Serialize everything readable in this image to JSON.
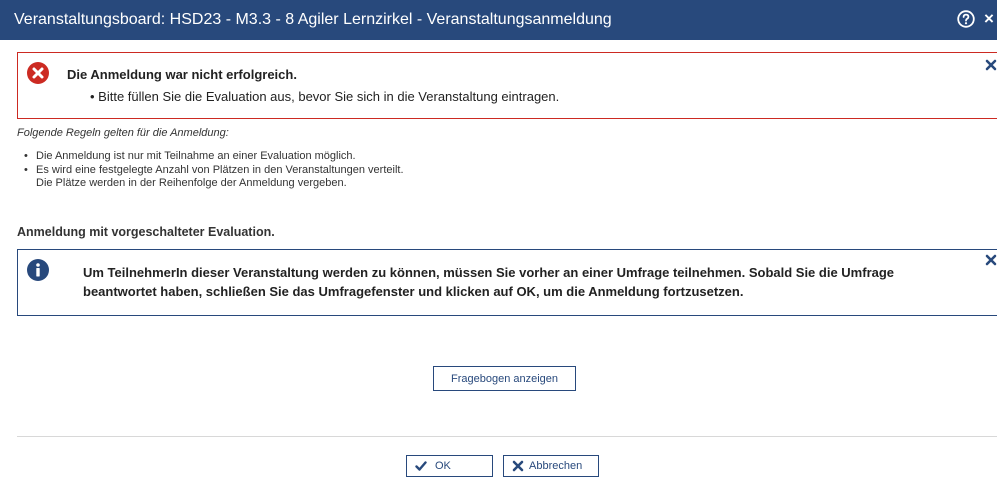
{
  "window": {
    "title": "Veranstaltungsboard: HSD23 - M3.3 - 8 Agiler Lernzirkel - Veranstaltungsanmeldung",
    "help_icon": "help-circle-icon",
    "close_icon": "close-icon",
    "close_glyph": "×"
  },
  "error_message": {
    "icon": "error-circle-icon",
    "title": "Die Anmeldung war nicht erfolgreich.",
    "bullet": "Bitte füllen Sie die Evaluation aus, bevor Sie sich in die Veranstaltung eintragen.",
    "color": "#cc2a22"
  },
  "rules": {
    "intro": "Folgende Regeln gelten für die Anmeldung:",
    "items": [
      {
        "text": "Die Anmeldung ist nur mit Teilnahme an einer Evaluation möglich."
      },
      {
        "text": "Es wird eine festgelegte Anzahl von Plätzen in den Veranstaltungen verteilt.",
        "continuation": "Die Plätze werden in der Reihenfolge der Anmeldung vergeben."
      }
    ]
  },
  "section_heading": "Anmeldung mit vorgeschalteter Evaluation.",
  "info_message": {
    "icon": "info-circle-icon",
    "text": "Um TeilnehmerIn dieser Veranstaltung werden zu können, müssen Sie vorher an einer Umfrage teilnehmen. Sobald Sie die Umfrage beantwortet haben, schließen Sie das Umfragefenster und klicken auf OK, um die Anmeldung fortzusetzen.",
    "color": "#28497c"
  },
  "survey_button_label": "Fragebogen anzeigen",
  "footer": {
    "ok_label": "OK",
    "ok_icon": "checkmark-icon",
    "cancel_label": "Abbrechen",
    "cancel_icon": "x-icon"
  },
  "colors": {
    "primary": "#28497c",
    "error": "#cc2a22"
  }
}
